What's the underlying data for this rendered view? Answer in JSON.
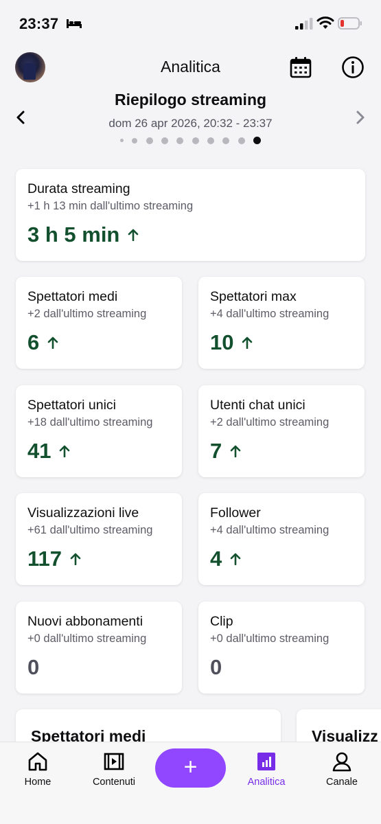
{
  "status": {
    "time": "23:37"
  },
  "header": {
    "title": "Analitica"
  },
  "summary": {
    "title": "Riepilogo streaming",
    "date_range": "dom 26 apr 2026, 20:32 - 23:37",
    "page_count": 10,
    "active_page": 10
  },
  "cards": {
    "duration": {
      "label": "Durata streaming",
      "sub": "+1 h 13 min dall'ultimo streaming",
      "value": "3 h 5 min",
      "trend": "up"
    },
    "avg_viewers": {
      "label": "Spettatori medi",
      "sub": "+2 dall'ultimo streaming",
      "value": "6",
      "trend": "up"
    },
    "max_viewers": {
      "label": "Spettatori max",
      "sub": "+4 dall'ultimo streaming",
      "value": "10",
      "trend": "up"
    },
    "unique_viewers": {
      "label": "Spettatori unici",
      "sub": "+18 dall'ultimo streaming",
      "value": "41",
      "trend": "up"
    },
    "unique_chatters": {
      "label": "Utenti chat unici",
      "sub": "+2 dall'ultimo streaming",
      "value": "7",
      "trend": "up"
    },
    "live_views": {
      "label": "Visualizzazioni live",
      "sub": "+61 dall'ultimo streaming",
      "value": "117",
      "trend": "up"
    },
    "followers": {
      "label": "Follower",
      "sub": "+4 dall'ultimo streaming",
      "value": "4",
      "trend": "up"
    },
    "new_subs": {
      "label": "Nuovi abbonamenti",
      "sub": "+0 dall'ultimo streaming",
      "value": "0",
      "trend": "none"
    },
    "clips": {
      "label": "Clip",
      "sub": "+0 dall'ultimo streaming",
      "value": "0",
      "trend": "none"
    }
  },
  "charts": [
    {
      "title": "Spettatori medi"
    },
    {
      "title": "Visualizz"
    }
  ],
  "nav": {
    "home": "Home",
    "content": "Contenuti",
    "create": "+",
    "analytics": "Analitica",
    "channel": "Canale"
  },
  "colors": {
    "accent": "#9147ff",
    "accent_text": "#772ce8",
    "positive": "#12502e",
    "neutral": "#50505c",
    "battery_low": "#e5342f"
  },
  "icons": {
    "calendar": "calendar-icon",
    "info": "info-icon",
    "prev": "chevron-left-icon",
    "next": "chevron-right-icon",
    "trend_up": "arrow-up-icon"
  }
}
